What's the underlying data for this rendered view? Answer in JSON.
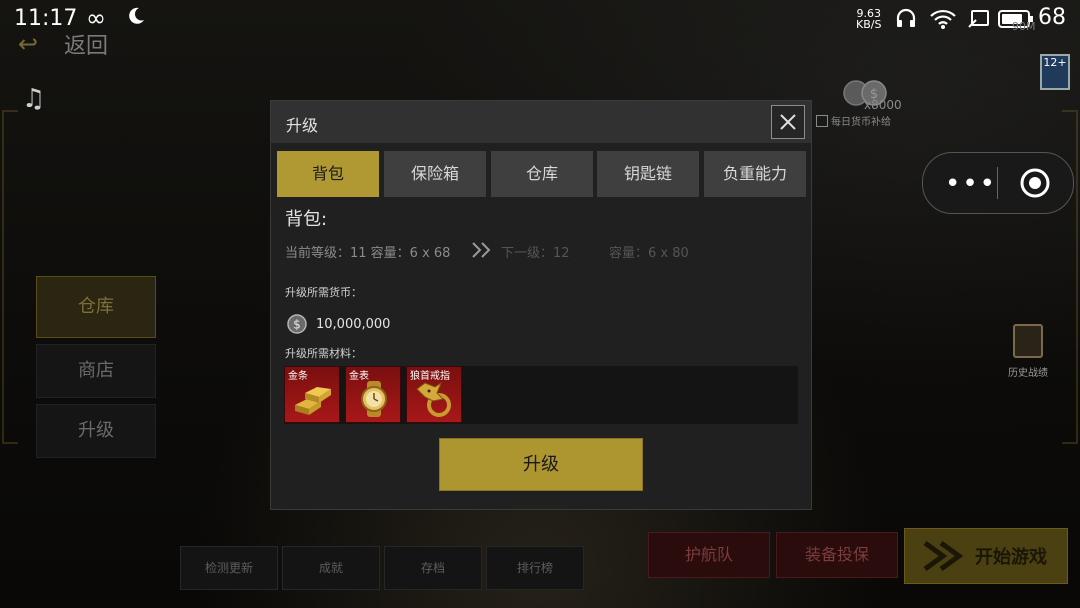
{
  "status_bar": {
    "time": "11:17",
    "net_speed_value": "9.63",
    "net_speed_unit": "KB/S",
    "battery": "68"
  },
  "background": {
    "back_label": "返回",
    "net_label": "90M",
    "coin_amount": "x8000",
    "daily_label": "每日货币补给",
    "age_rating": "12+",
    "history_label": "历史战绩",
    "left_nav": [
      "仓库",
      "商店",
      "升级"
    ],
    "bottom_buttons": [
      "检测更新",
      "成就",
      "存档",
      "排行榜"
    ],
    "escort_label": "护航队",
    "equip_label": "装备投保",
    "start_label": "开始游戏"
  },
  "dialog": {
    "title": "升级",
    "tabs": [
      "背包",
      "保险箱",
      "仓库",
      "钥匙链",
      "负重能力"
    ],
    "active_tab": 0,
    "section_title": "背包:",
    "current_level": "当前等级：11  容量：6 x 68",
    "next_level": "下一级：12",
    "next_capacity": "容量：6 x 80",
    "cost_label": "升级所需货币：",
    "cost_amount": "10,000,000",
    "materials_label": "升级所需材料：",
    "materials": [
      {
        "name": "金条",
        "icon": "gold-bar-icon"
      },
      {
        "name": "金表",
        "icon": "gold-watch-icon"
      },
      {
        "name": "狼首戒指",
        "icon": "wolf-ring-icon"
      }
    ],
    "upgrade_button": "升级"
  },
  "colors": {
    "gold_accent": "#b09832",
    "material_red": "#a81818",
    "dialog_bg": "#202020"
  }
}
